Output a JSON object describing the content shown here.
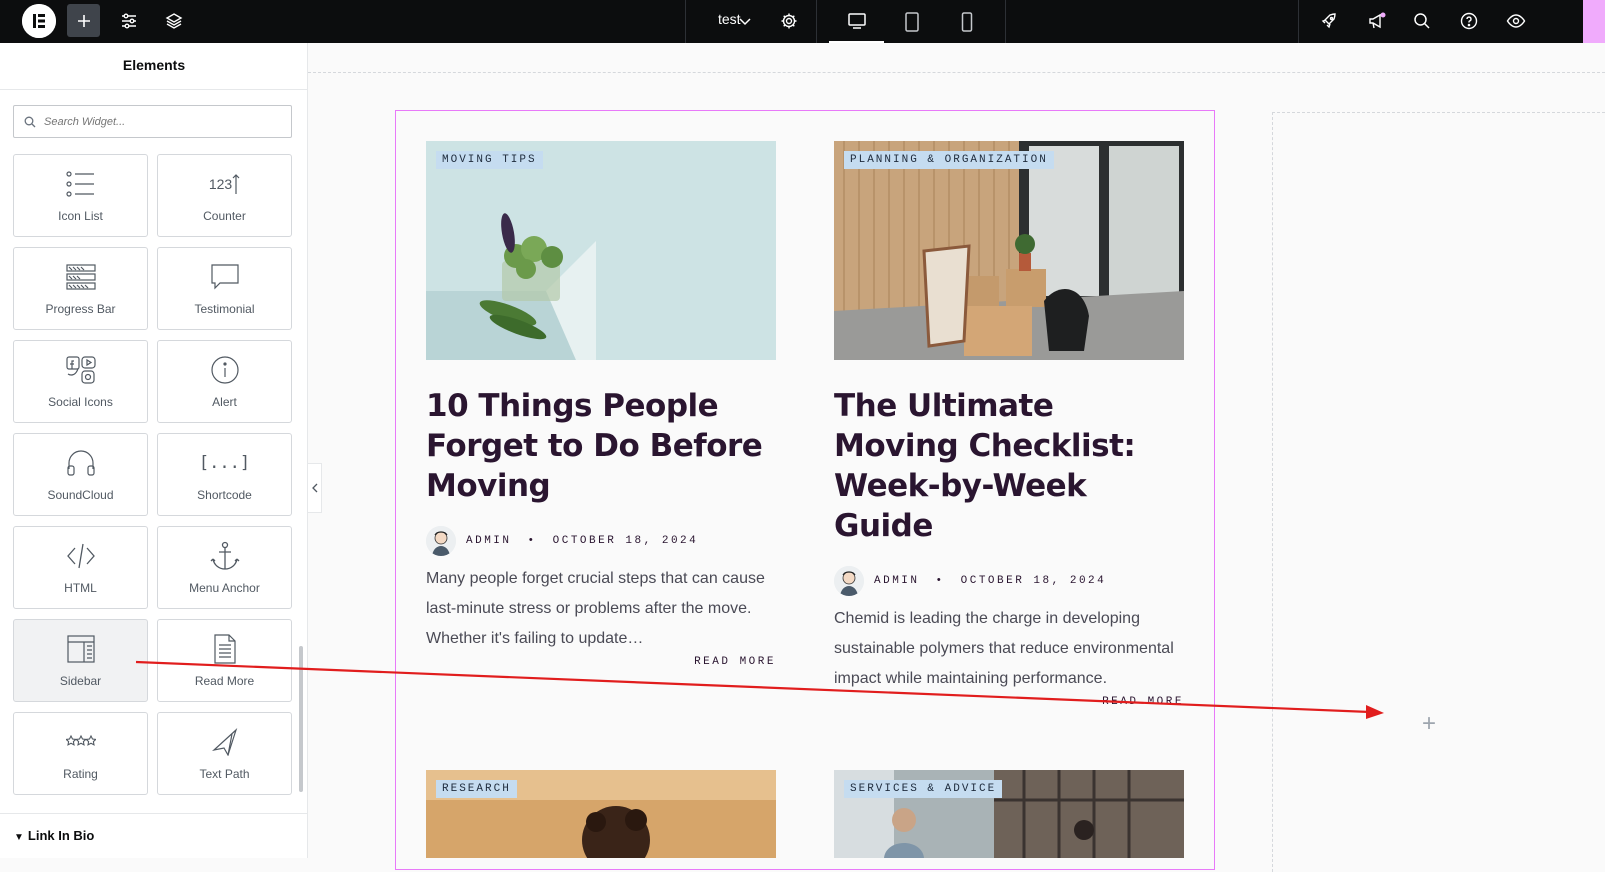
{
  "topbar": {
    "doc_title": "test",
    "icons": [
      "elementor-logo-icon",
      "add-icon",
      "settings-sliders-icon",
      "layers-icon",
      "chevron-down-icon",
      "gear-icon",
      "desktop-icon",
      "tablet-icon",
      "mobile-icon",
      "rocket-icon",
      "megaphone-icon",
      "search-icon",
      "help-icon",
      "eye-icon"
    ],
    "accent_color": "#f0abfc"
  },
  "sidebar": {
    "title": "Elements",
    "search_placeholder": "Search Widget...",
    "widgets": [
      {
        "label": "Icon List",
        "icon": "icon-list-icon"
      },
      {
        "label": "Counter",
        "icon": "counter-icon"
      },
      {
        "label": "Progress Bar",
        "icon": "progress-bar-icon"
      },
      {
        "label": "Testimonial",
        "icon": "testimonial-icon"
      },
      {
        "label": "Social Icons",
        "icon": "social-icons-icon"
      },
      {
        "label": "Alert",
        "icon": "alert-icon"
      },
      {
        "label": "SoundCloud",
        "icon": "headphones-icon"
      },
      {
        "label": "Shortcode",
        "icon": "shortcode-icon"
      },
      {
        "label": "HTML",
        "icon": "code-icon"
      },
      {
        "label": "Menu Anchor",
        "icon": "anchor-icon"
      },
      {
        "label": "Sidebar",
        "icon": "sidebar-icon"
      },
      {
        "label": "Read More",
        "icon": "read-more-icon"
      },
      {
        "label": "Rating",
        "icon": "rating-icon"
      },
      {
        "label": "Text Path",
        "icon": "text-path-icon"
      }
    ],
    "counter_icon_text": "123",
    "shortcode_icon_text": "[...]",
    "section_label": "Link In Bio"
  },
  "posts": [
    {
      "category": "MOVING TIPS",
      "title": "10 Things People Forget to Do Before Moving",
      "author": "ADMIN",
      "date": "OCTOBER 18, 2024",
      "excerpt": "Many people forget crucial steps that can cause last-minute stress or problems after the move. Whether it's failing to update…",
      "read_more": "READ MORE"
    },
    {
      "category": "PLANNING & ORGANIZATION",
      "title": "The Ultimate Moving Checklist: Week-by-Week Guide",
      "author": "ADMIN",
      "date": "OCTOBER 18, 2024",
      "excerpt": "Chemid is leading the charge in developing sustainable polymers that reduce environmental impact while maintaining performance.",
      "read_more": "READ MORE"
    },
    {
      "category": "RESEARCH"
    },
    {
      "category": "SERVICES & ADVICE"
    }
  ],
  "meta_separator": "•",
  "drop_zone_symbol": "+",
  "colors": {
    "container_border": "#e879f9",
    "drag_arrow": "#e11d1d",
    "category_badge": "#c5dcf0",
    "heading": "#2a1530"
  }
}
